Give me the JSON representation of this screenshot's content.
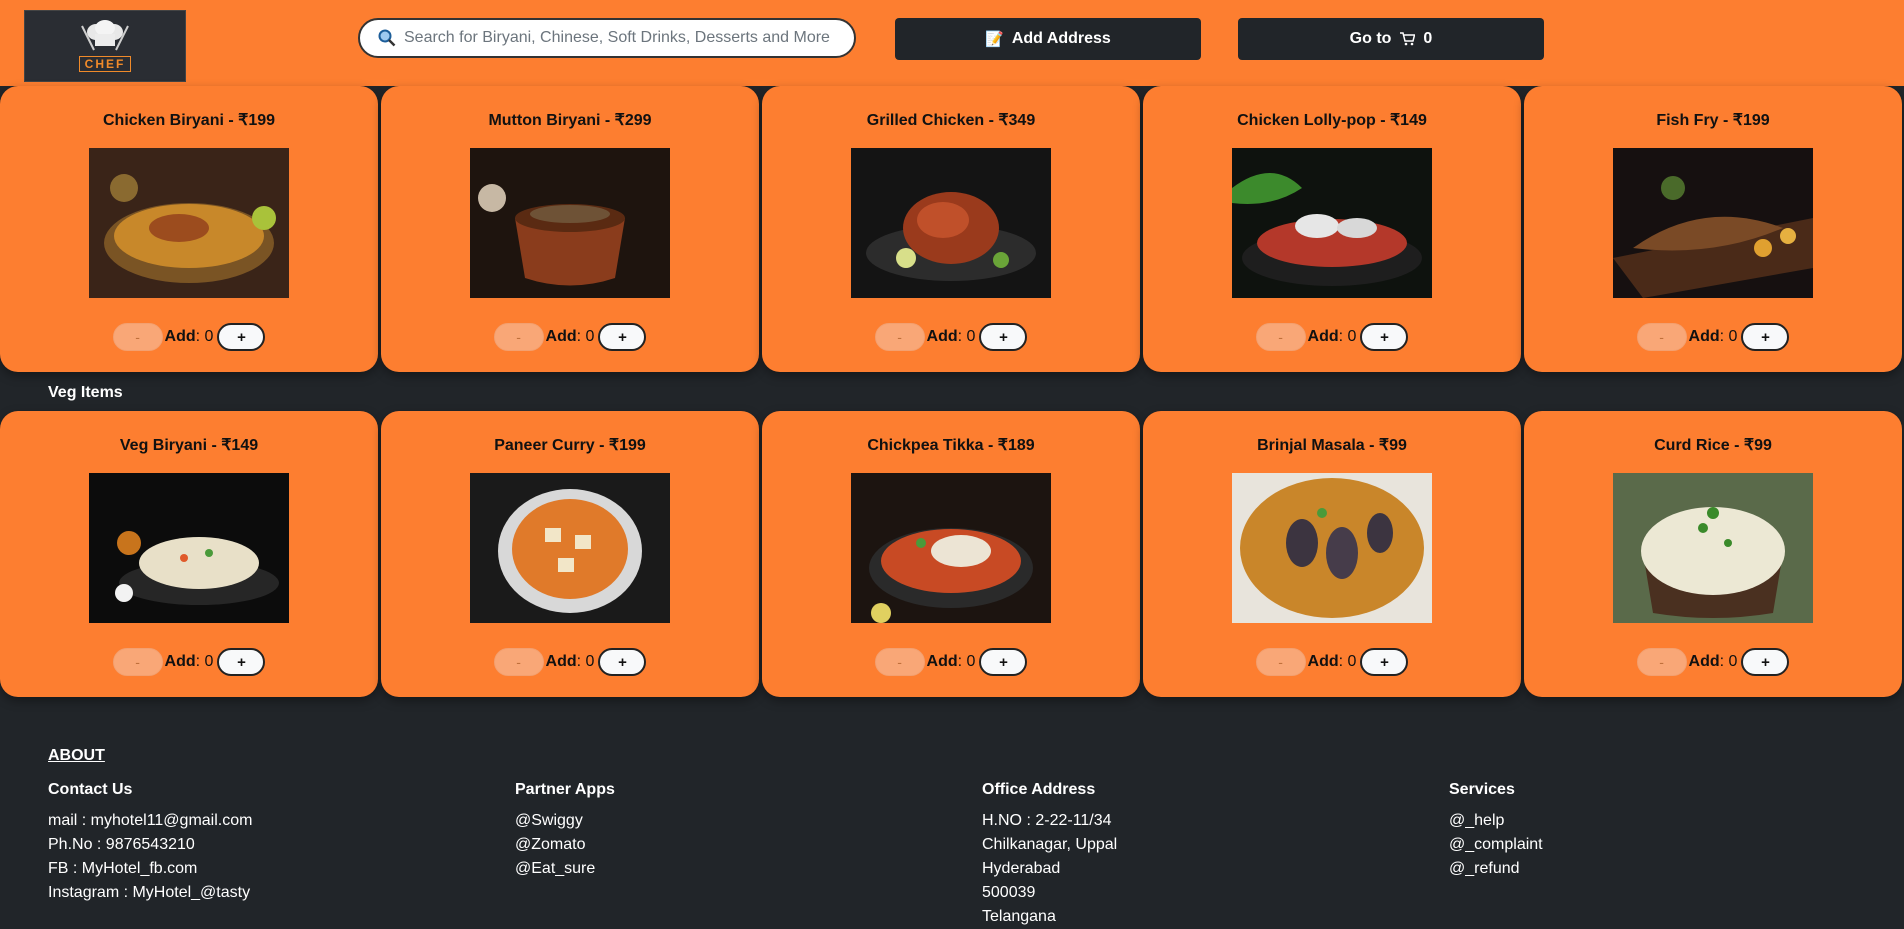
{
  "header": {
    "logo_text": "CHEF",
    "search_placeholder": "Search for Biryani, Chinese, Soft Drinks, Desserts and More",
    "add_address_label": "Add Address",
    "goto_label": "Go to",
    "cart_count": "0"
  },
  "nonveg": [
    {
      "title": "Chicken Biryani - ₹199",
      "minus": "-",
      "add_label": "Add",
      "count": "0",
      "plus": "+"
    },
    {
      "title": "Mutton Biryani - ₹299",
      "minus": "-",
      "add_label": "Add",
      "count": "0",
      "plus": "+"
    },
    {
      "title": "Grilled Chicken - ₹349",
      "minus": "-",
      "add_label": "Add",
      "count": "0",
      "plus": "+"
    },
    {
      "title": "Chicken Lolly-pop - ₹149",
      "minus": "-",
      "add_label": "Add",
      "count": "0",
      "plus": "+"
    },
    {
      "title": "Fish Fry - ₹199",
      "minus": "-",
      "add_label": "Add",
      "count": "0",
      "plus": "+"
    }
  ],
  "veg_section_title": "Veg Items",
  "veg": [
    {
      "title": "Veg Biryani - ₹149",
      "minus": "-",
      "add_label": "Add",
      "count": "0",
      "plus": "+"
    },
    {
      "title": "Paneer Curry - ₹199",
      "minus": "-",
      "add_label": "Add",
      "count": "0",
      "plus": "+"
    },
    {
      "title": "Chickpea Tikka - ₹189",
      "minus": "-",
      "add_label": "Add",
      "count": "0",
      "plus": "+"
    },
    {
      "title": "Brinjal Masala - ₹99",
      "minus": "-",
      "add_label": "Add",
      "count": "0",
      "plus": "+"
    },
    {
      "title": "Curd Rice - ₹99",
      "minus": "-",
      "add_label": "Add",
      "count": "0",
      "plus": "+"
    }
  ],
  "footer": {
    "about": "ABOUT",
    "contact": {
      "title": "Contact Us",
      "lines": [
        "mail : myhotel11@gmail.com",
        "Ph.No : 9876543210",
        "FB : MyHotel_fb.com",
        "Instagram : MyHotel_@tasty"
      ]
    },
    "partners": {
      "title": "Partner Apps",
      "lines": [
        "@Swiggy",
        "@Zomato",
        "@Eat_sure"
      ]
    },
    "office": {
      "title": "Office Address",
      "lines": [
        "H.NO : 2-22-11/34",
        "Chilkanagar, Uppal",
        "Hyderabad",
        "500039",
        "Telangana"
      ]
    },
    "services": {
      "title": "Services",
      "lines": [
        "@_help",
        "@_complaint",
        "@_refund"
      ]
    }
  },
  "colors": {
    "accent": "#fd7e30",
    "dark": "#212529"
  }
}
